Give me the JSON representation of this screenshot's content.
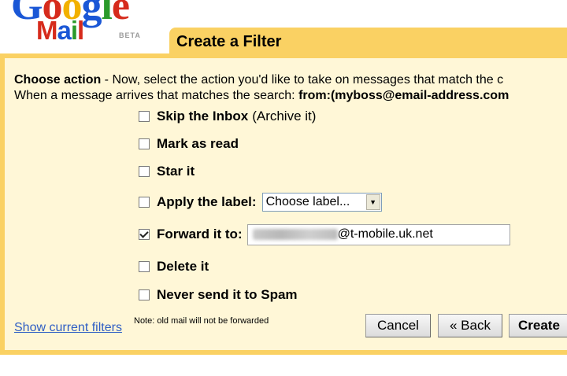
{
  "logo": {
    "word_google": "Google",
    "word_mail": "Mail",
    "beta": "BETA"
  },
  "header": {
    "title": "Create a Filter"
  },
  "instructions": {
    "heading": "Choose action",
    "line1_rest": " - Now, select the action you'd like to take on messages that match the c",
    "line2_prefix": "When a message arrives that matches the search: ",
    "line2_query": "from:(myboss@email-address.com"
  },
  "options": [
    {
      "label": "Skip the Inbox",
      "note": "(Archive it)",
      "checked": false
    },
    {
      "label": "Mark as read",
      "note": "",
      "checked": false
    },
    {
      "label": "Star it",
      "note": "",
      "checked": false
    },
    {
      "label": "Apply the label:",
      "note": "",
      "checked": false
    },
    {
      "label": "Forward it to:",
      "note": "",
      "checked": true
    },
    {
      "label": "Delete it",
      "note": "",
      "checked": false
    },
    {
      "label": "Never send it to Spam",
      "note": "",
      "checked": false
    }
  ],
  "label_select": {
    "selected": "Choose label..."
  },
  "forward": {
    "value_domain": "@t-mobile.uk.net"
  },
  "footer": {
    "show_filters": "Show current filters",
    "note": "Note: old mail will not be forwarded"
  },
  "buttons": {
    "cancel": "Cancel",
    "back": "« Back",
    "create": "Create"
  },
  "colors": {
    "panel": "#fad163",
    "panel_inner": "#fff7d7",
    "link": "#2f5ec4"
  }
}
